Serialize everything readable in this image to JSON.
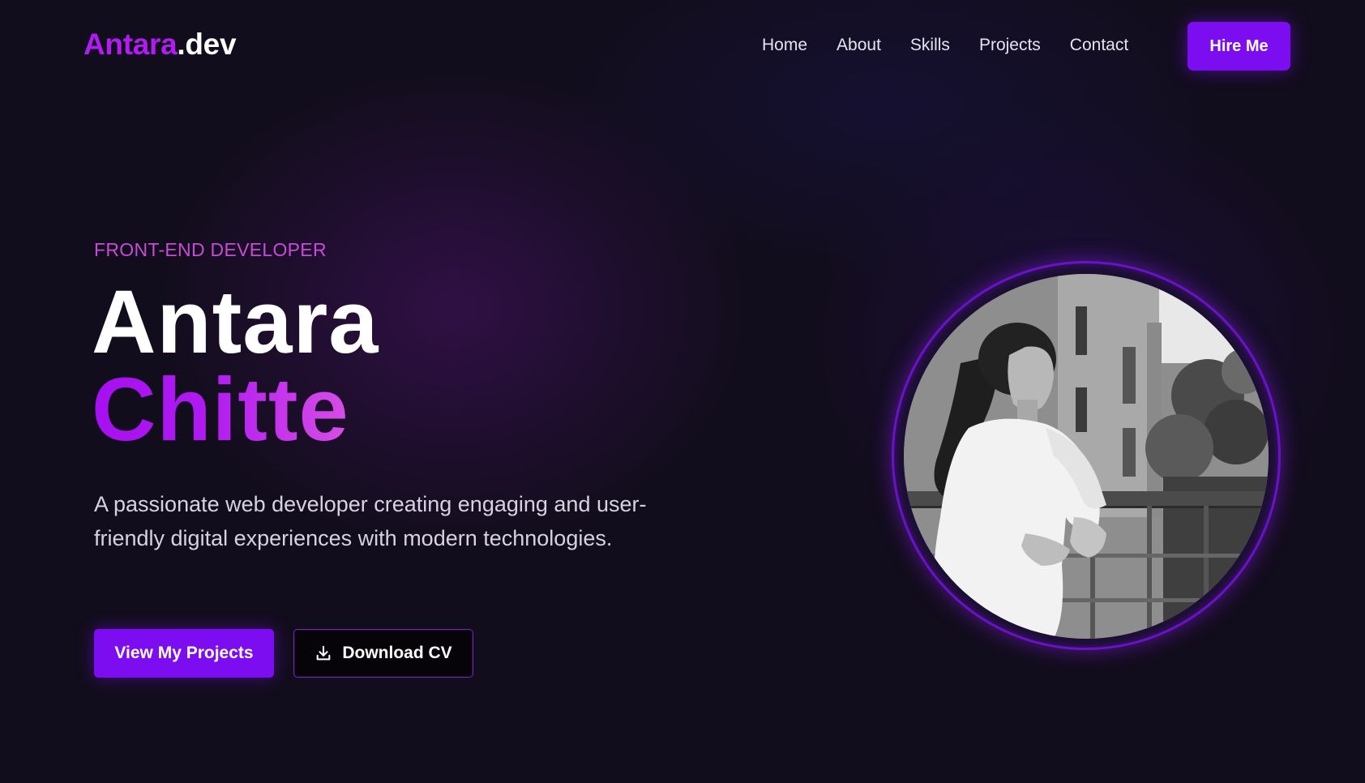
{
  "nav": {
    "logo_brand": "Antara",
    "logo_tld": ".dev",
    "links": [
      "Home",
      "About",
      "Skills",
      "Projects",
      "Contact"
    ],
    "hire_label": "Hire Me"
  },
  "hero": {
    "role": "FRONT-END DEVELOPER",
    "first_name": "Antara",
    "last_name": "Chitte",
    "tagline": "A passionate web developer creating engaging and user-friendly digital experiences with modern technologies.",
    "primary_button": "View My Projects",
    "secondary_button": "Download CV",
    "secondary_icon": "download-icon"
  },
  "portrait": {
    "icon": "profile-photo"
  },
  "colors": {
    "accent": "#7c0df0",
    "accent_gradient_start": "#a60ff0",
    "accent_gradient_end": "#d74ee6",
    "role_text": "#c84bd8",
    "background": "#120d1c"
  }
}
